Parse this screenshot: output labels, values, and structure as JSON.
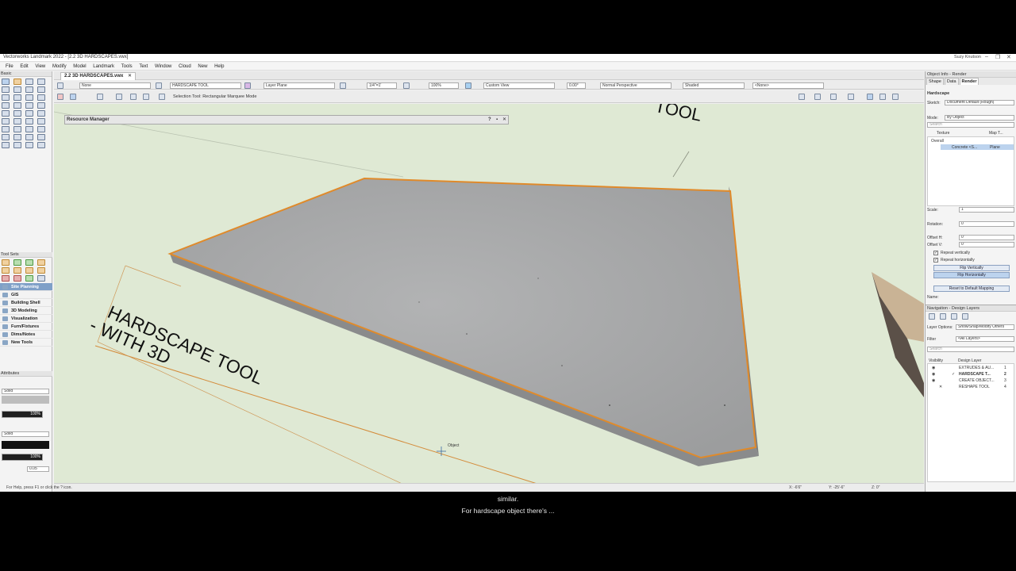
{
  "app": {
    "window_title": "Vectorworks Landmark 2022 - [2.2 3D HARDSCAPES.vwx]",
    "user": "Suzy Knutson",
    "win_controls": [
      "–",
      "❐",
      "✕"
    ]
  },
  "menu": [
    "File",
    "Edit",
    "View",
    "Modify",
    "Model",
    "Landmark",
    "Tools",
    "Text",
    "Window",
    "Cloud",
    "New",
    "Help"
  ],
  "tab": {
    "label": "2.2 3D HARDSCAPES.vwx",
    "close": "✕"
  },
  "viewbar": {
    "class_value": "None",
    "layer_name": "HARDSCAPE TOOL",
    "layer_plane": "Layer Plane",
    "scale": "1/4\"=1'",
    "zoom": "100%",
    "rotation": "0.00°",
    "view": "Custom View",
    "projection": "Normal Perspective",
    "render_mode": "Shaded",
    "saved_view": "<None>"
  },
  "modebar": {
    "hint": "Selection Tool: Rectangular Marquee Mode"
  },
  "toolbox": {
    "basic_label": "Basic",
    "toolsets_label": "Tool Sets",
    "toolsets": [
      "Site Planning",
      "GIS",
      "Building Shell",
      "3D Modeling",
      "Visualization",
      "Furn/Fixtures",
      "Dims/Notes",
      "New Tools"
    ],
    "selected_toolset": "Site Planning",
    "attributes_label": "Attributes",
    "fill_style": "Solid",
    "fill_opacity": "100%",
    "pen_style": "Solid",
    "pen_opacity": "100%",
    "line_weight": "0.05"
  },
  "resource_manager": {
    "title": "Resource Manager",
    "buttons": [
      "?",
      "▪",
      "✕"
    ]
  },
  "viewport": {
    "sign_main": "HARDSCAPE TOOL",
    "sign_sub": "- WITH 3D",
    "top_text": "TOOL",
    "cursor_label": "Object"
  },
  "status": {
    "help": "For Help, press F1 or click the ? icon.",
    "x": "X: -6'6\"",
    "y": "Y: -25'-6\"",
    "z": "Z: 0\""
  },
  "object_info": {
    "title": "Object Info - Render",
    "tabs": [
      "Shape",
      "Data",
      "Render"
    ],
    "active_tab": "Render",
    "object_type": "Hardscape",
    "sketch_label": "Sketch:",
    "sketch_value": "Document Default (Rough)",
    "mode_label": "Mode:",
    "mode_value": "By Object",
    "search_placeholder": "Search",
    "col_texture": "Texture",
    "col_map": "Map T...",
    "tree_overall": "Overall",
    "tree_item": "Concrete <S...",
    "tree_map": "Plane",
    "scale_label": "Scale:",
    "scale_value": "1",
    "rotation_label": "Rotation:",
    "rotation_value": "0",
    "offset_h_label": "Offset H:",
    "offset_h_value": "0\"",
    "offset_v_label": "Offset V:",
    "offset_v_value": "0\"",
    "repeat_v": "Repeat vertically",
    "repeat_h": "Repeat horizontally",
    "flip_v": "Flip Vertically",
    "flip_h": "Flip Horizontally",
    "reset": "Reset to Default Mapping",
    "name_label": "Name:"
  },
  "navigation": {
    "title": "Navigation - Design Layers",
    "layer_options_label": "Layer Options:",
    "layer_options_value": "Show/Snap/Modify Others",
    "filter_label": "Filter",
    "filter_value": "<All Layers>",
    "search_placeholder": "Search",
    "col_visibility": "Visibility",
    "col_layer": "Design Layer",
    "layers": [
      {
        "name": "EXTRUDES & AU...",
        "num": "1",
        "active": false,
        "vis": "◉"
      },
      {
        "name": "HARDSCAPE T...",
        "num": "2",
        "active": true,
        "vis": "◉"
      },
      {
        "name": "CREATE OBJECT...",
        "num": "3",
        "active": false,
        "vis": "◉"
      },
      {
        "name": "RESHAPE TOOL",
        "num": "4",
        "active": false,
        "vis": "✕"
      }
    ]
  },
  "captions": {
    "line1": "similar.",
    "line2": "For hardscape object there's ..."
  },
  "colors": {
    "viewport_bg": "#dfe9d4",
    "slab_top": "#a9aaab",
    "slab_edge": "#e08a2a",
    "toolset_selected": "#7fa0c8"
  }
}
